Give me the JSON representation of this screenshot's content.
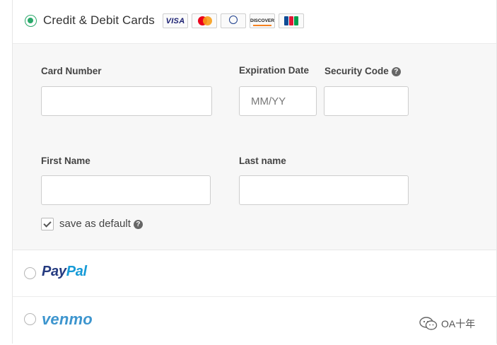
{
  "payment": {
    "card_method": {
      "label": "Credit & Debit Cards",
      "selected": true,
      "logos": {
        "visa": "VISA",
        "discover": "DISCOVER"
      }
    },
    "form": {
      "card_number_label": "Card Number",
      "card_number_value": "",
      "expiration_label": "Expiration Date",
      "expiration_placeholder": "MM/YY",
      "security_code_label": "Security Code",
      "security_code_value": "",
      "first_name_label": "First Name",
      "first_name_value": "",
      "last_name_label": "Last name",
      "last_name_value": "",
      "save_default_label": "save as default",
      "save_default_checked": true,
      "help_glyph": "?"
    },
    "paypal": {
      "logo_part1": "Pay",
      "logo_part2": "Pal",
      "selected": false
    },
    "venmo": {
      "logo": "venmo",
      "selected": false
    }
  },
  "watermark": {
    "icon": "wechat-icon",
    "text": "OA十年"
  },
  "colors": {
    "accent_green": "#2aa86a",
    "paypal_dark": "#253b80",
    "paypal_light": "#179bd7",
    "venmo_blue": "#3d95ce"
  }
}
